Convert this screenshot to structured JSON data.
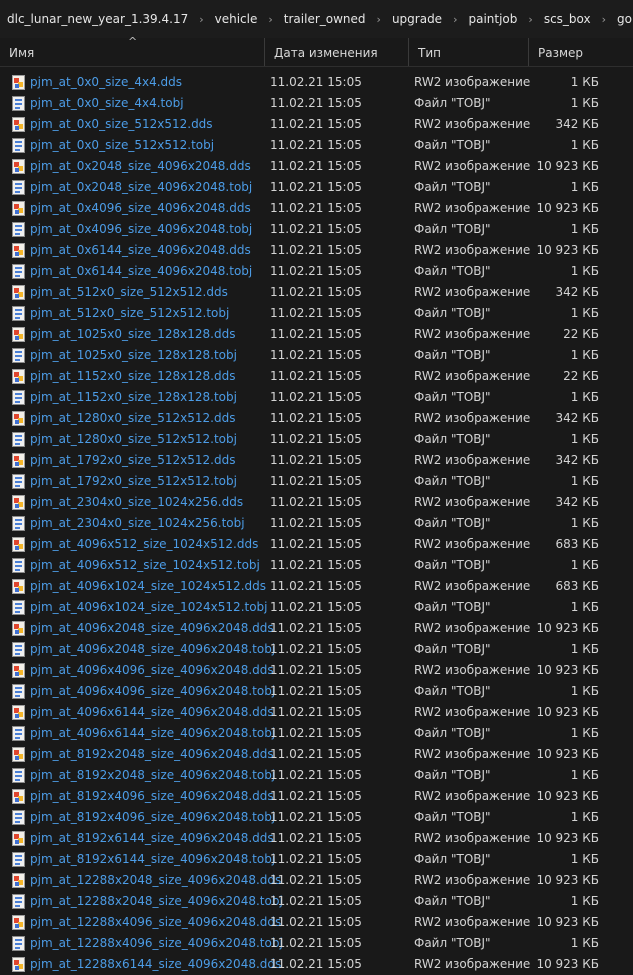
{
  "breadcrumb": [
    "dlc_lunar_new_year_1.39.4.17",
    "vehicle",
    "trailer_owned",
    "upgrade",
    "paintjob",
    "scs_box",
    "gold"
  ],
  "columns": {
    "name": "Имя",
    "date": "Дата изменения",
    "type": "Тип",
    "size": "Размер",
    "sort_indicator": "^"
  },
  "files": [
    {
      "name": "pjm_at_0x0_size_4x4.dds",
      "date": "11.02.21 15:05",
      "type": "RW2 изображение",
      "size": "1 КБ",
      "icon": "rw2-image-icon"
    },
    {
      "name": "pjm_at_0x0_size_4x4.tobj",
      "date": "11.02.21 15:05",
      "type": "Файл \"TOBJ\"",
      "size": "1 КБ",
      "icon": "tobj-file-icon"
    },
    {
      "name": "pjm_at_0x0_size_512x512.dds",
      "date": "11.02.21 15:05",
      "type": "RW2 изображение",
      "size": "342 КБ",
      "icon": "rw2-image-icon"
    },
    {
      "name": "pjm_at_0x0_size_512x512.tobj",
      "date": "11.02.21 15:05",
      "type": "Файл \"TOBJ\"",
      "size": "1 КБ",
      "icon": "tobj-file-icon"
    },
    {
      "name": "pjm_at_0x2048_size_4096x2048.dds",
      "date": "11.02.21 15:05",
      "type": "RW2 изображение",
      "size": "10 923 КБ",
      "icon": "rw2-image-icon"
    },
    {
      "name": "pjm_at_0x2048_size_4096x2048.tobj",
      "date": "11.02.21 15:05",
      "type": "Файл \"TOBJ\"",
      "size": "1 КБ",
      "icon": "tobj-file-icon"
    },
    {
      "name": "pjm_at_0x4096_size_4096x2048.dds",
      "date": "11.02.21 15:05",
      "type": "RW2 изображение",
      "size": "10 923 КБ",
      "icon": "rw2-image-icon"
    },
    {
      "name": "pjm_at_0x4096_size_4096x2048.tobj",
      "date": "11.02.21 15:05",
      "type": "Файл \"TOBJ\"",
      "size": "1 КБ",
      "icon": "tobj-file-icon"
    },
    {
      "name": "pjm_at_0x6144_size_4096x2048.dds",
      "date": "11.02.21 15:05",
      "type": "RW2 изображение",
      "size": "10 923 КБ",
      "icon": "rw2-image-icon"
    },
    {
      "name": "pjm_at_0x6144_size_4096x2048.tobj",
      "date": "11.02.21 15:05",
      "type": "Файл \"TOBJ\"",
      "size": "1 КБ",
      "icon": "tobj-file-icon"
    },
    {
      "name": "pjm_at_512x0_size_512x512.dds",
      "date": "11.02.21 15:05",
      "type": "RW2 изображение",
      "size": "342 КБ",
      "icon": "rw2-image-icon"
    },
    {
      "name": "pjm_at_512x0_size_512x512.tobj",
      "date": "11.02.21 15:05",
      "type": "Файл \"TOBJ\"",
      "size": "1 КБ",
      "icon": "tobj-file-icon"
    },
    {
      "name": "pjm_at_1025x0_size_128x128.dds",
      "date": "11.02.21 15:05",
      "type": "RW2 изображение",
      "size": "22 КБ",
      "icon": "rw2-image-icon"
    },
    {
      "name": "pjm_at_1025x0_size_128x128.tobj",
      "date": "11.02.21 15:05",
      "type": "Файл \"TOBJ\"",
      "size": "1 КБ",
      "icon": "tobj-file-icon"
    },
    {
      "name": "pjm_at_1152x0_size_128x128.dds",
      "date": "11.02.21 15:05",
      "type": "RW2 изображение",
      "size": "22 КБ",
      "icon": "rw2-image-icon"
    },
    {
      "name": "pjm_at_1152x0_size_128x128.tobj",
      "date": "11.02.21 15:05",
      "type": "Файл \"TOBJ\"",
      "size": "1 КБ",
      "icon": "tobj-file-icon"
    },
    {
      "name": "pjm_at_1280x0_size_512x512.dds",
      "date": "11.02.21 15:05",
      "type": "RW2 изображение",
      "size": "342 КБ",
      "icon": "rw2-image-icon"
    },
    {
      "name": "pjm_at_1280x0_size_512x512.tobj",
      "date": "11.02.21 15:05",
      "type": "Файл \"TOBJ\"",
      "size": "1 КБ",
      "icon": "tobj-file-icon"
    },
    {
      "name": "pjm_at_1792x0_size_512x512.dds",
      "date": "11.02.21 15:05",
      "type": "RW2 изображение",
      "size": "342 КБ",
      "icon": "rw2-image-icon"
    },
    {
      "name": "pjm_at_1792x0_size_512x512.tobj",
      "date": "11.02.21 15:05",
      "type": "Файл \"TOBJ\"",
      "size": "1 КБ",
      "icon": "tobj-file-icon"
    },
    {
      "name": "pjm_at_2304x0_size_1024x256.dds",
      "date": "11.02.21 15:05",
      "type": "RW2 изображение",
      "size": "342 КБ",
      "icon": "rw2-image-icon"
    },
    {
      "name": "pjm_at_2304x0_size_1024x256.tobj",
      "date": "11.02.21 15:05",
      "type": "Файл \"TOBJ\"",
      "size": "1 КБ",
      "icon": "tobj-file-icon"
    },
    {
      "name": "pjm_at_4096x512_size_1024x512.dds",
      "date": "11.02.21 15:05",
      "type": "RW2 изображение",
      "size": "683 КБ",
      "icon": "rw2-image-icon"
    },
    {
      "name": "pjm_at_4096x512_size_1024x512.tobj",
      "date": "11.02.21 15:05",
      "type": "Файл \"TOBJ\"",
      "size": "1 КБ",
      "icon": "tobj-file-icon"
    },
    {
      "name": "pjm_at_4096x1024_size_1024x512.dds",
      "date": "11.02.21 15:05",
      "type": "RW2 изображение",
      "size": "683 КБ",
      "icon": "rw2-image-icon"
    },
    {
      "name": "pjm_at_4096x1024_size_1024x512.tobj",
      "date": "11.02.21 15:05",
      "type": "Файл \"TOBJ\"",
      "size": "1 КБ",
      "icon": "tobj-file-icon"
    },
    {
      "name": "pjm_at_4096x2048_size_4096x2048.dds",
      "date": "11.02.21 15:05",
      "type": "RW2 изображение",
      "size": "10 923 КБ",
      "icon": "rw2-image-icon"
    },
    {
      "name": "pjm_at_4096x2048_size_4096x2048.tobj",
      "date": "11.02.21 15:05",
      "type": "Файл \"TOBJ\"",
      "size": "1 КБ",
      "icon": "tobj-file-icon"
    },
    {
      "name": "pjm_at_4096x4096_size_4096x2048.dds",
      "date": "11.02.21 15:05",
      "type": "RW2 изображение",
      "size": "10 923 КБ",
      "icon": "rw2-image-icon"
    },
    {
      "name": "pjm_at_4096x4096_size_4096x2048.tobj",
      "date": "11.02.21 15:05",
      "type": "Файл \"TOBJ\"",
      "size": "1 КБ",
      "icon": "tobj-file-icon"
    },
    {
      "name": "pjm_at_4096x6144_size_4096x2048.dds",
      "date": "11.02.21 15:05",
      "type": "RW2 изображение",
      "size": "10 923 КБ",
      "icon": "rw2-image-icon"
    },
    {
      "name": "pjm_at_4096x6144_size_4096x2048.tobj",
      "date": "11.02.21 15:05",
      "type": "Файл \"TOBJ\"",
      "size": "1 КБ",
      "icon": "tobj-file-icon"
    },
    {
      "name": "pjm_at_8192x2048_size_4096x2048.dds",
      "date": "11.02.21 15:05",
      "type": "RW2 изображение",
      "size": "10 923 КБ",
      "icon": "rw2-image-icon"
    },
    {
      "name": "pjm_at_8192x2048_size_4096x2048.tobj",
      "date": "11.02.21 15:05",
      "type": "Файл \"TOBJ\"",
      "size": "1 КБ",
      "icon": "tobj-file-icon"
    },
    {
      "name": "pjm_at_8192x4096_size_4096x2048.dds",
      "date": "11.02.21 15:05",
      "type": "RW2 изображение",
      "size": "10 923 КБ",
      "icon": "rw2-image-icon"
    },
    {
      "name": "pjm_at_8192x4096_size_4096x2048.tobj",
      "date": "11.02.21 15:05",
      "type": "Файл \"TOBJ\"",
      "size": "1 КБ",
      "icon": "tobj-file-icon"
    },
    {
      "name": "pjm_at_8192x6144_size_4096x2048.dds",
      "date": "11.02.21 15:05",
      "type": "RW2 изображение",
      "size": "10 923 КБ",
      "icon": "rw2-image-icon"
    },
    {
      "name": "pjm_at_8192x6144_size_4096x2048.tobj",
      "date": "11.02.21 15:05",
      "type": "Файл \"TOBJ\"",
      "size": "1 КБ",
      "icon": "tobj-file-icon"
    },
    {
      "name": "pjm_at_12288x2048_size_4096x2048.dds",
      "date": "11.02.21 15:05",
      "type": "RW2 изображение",
      "size": "10 923 КБ",
      "icon": "rw2-image-icon"
    },
    {
      "name": "pjm_at_12288x2048_size_4096x2048.tobj",
      "date": "11.02.21 15:05",
      "type": "Файл \"TOBJ\"",
      "size": "1 КБ",
      "icon": "tobj-file-icon"
    },
    {
      "name": "pjm_at_12288x4096_size_4096x2048.dds",
      "date": "11.02.21 15:05",
      "type": "RW2 изображение",
      "size": "10 923 КБ",
      "icon": "rw2-image-icon"
    },
    {
      "name": "pjm_at_12288x4096_size_4096x2048.tobj",
      "date": "11.02.21 15:05",
      "type": "Файл \"TOBJ\"",
      "size": "1 КБ",
      "icon": "tobj-file-icon"
    },
    {
      "name": "pjm_at_12288x6144_size_4096x2048.dds",
      "date": "11.02.21 15:05",
      "type": "RW2 изображение",
      "size": "10 923 КБ",
      "icon": "rw2-image-icon"
    }
  ],
  "colors": {
    "background": "#191919",
    "file_name": "#4c9ce6",
    "text": "#d4d4d4"
  }
}
